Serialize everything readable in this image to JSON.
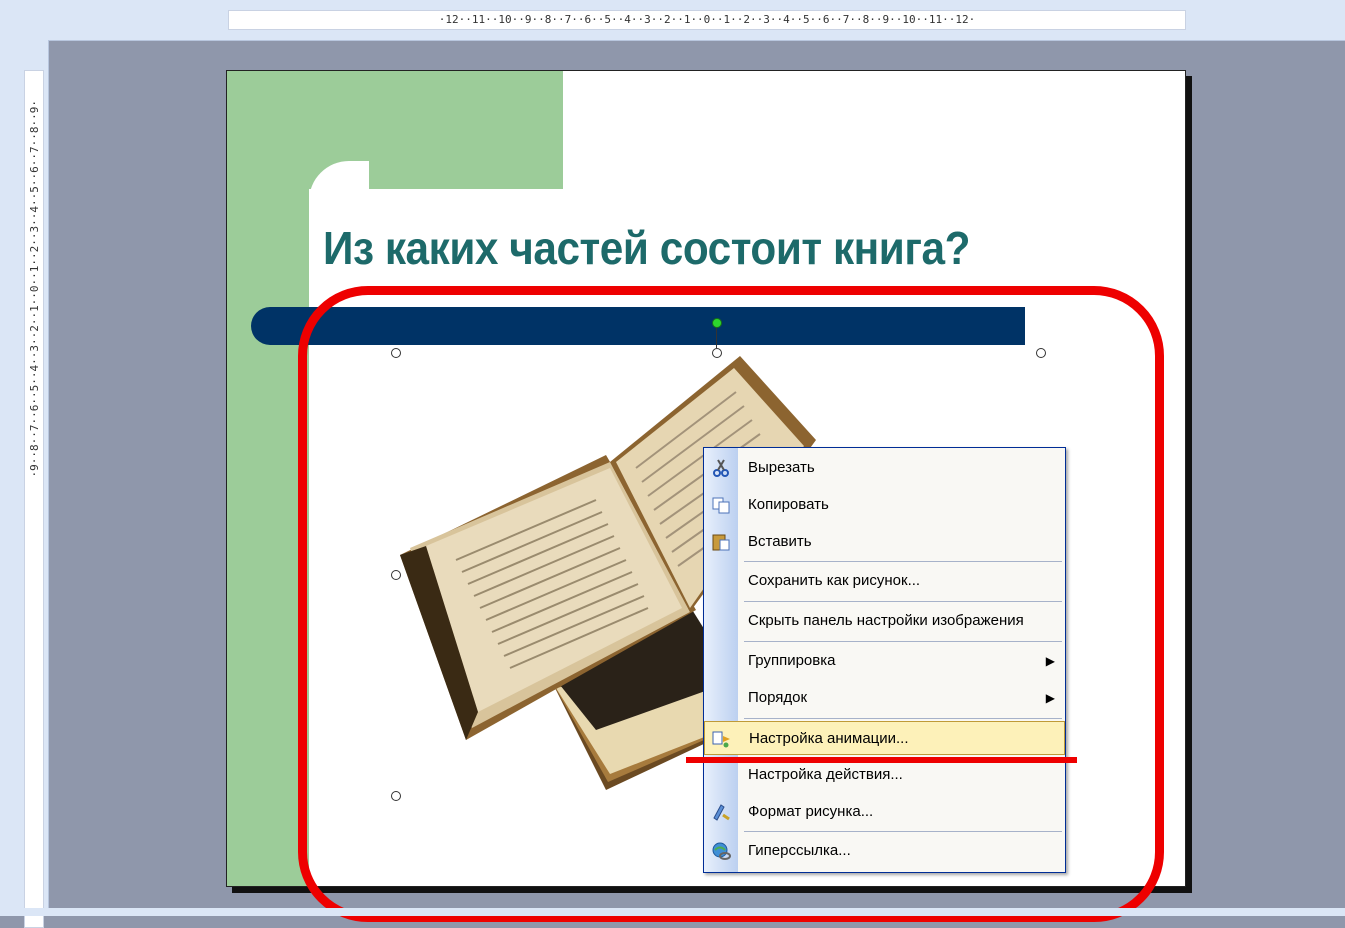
{
  "ruler": {
    "horizontal": "·12··11··10··9··8··7··6··5··4··3··2··1··0··1··2··3··4··5··6··7··8··9··10··11··12·",
    "vertical": "·9··8··7··6··5··4··3··2··1··0··1··2··3··4··5··6··7··8··9·"
  },
  "slide": {
    "title": "Из каких частей состоит книга?"
  },
  "context_menu": {
    "items": [
      {
        "label": "Вырезать",
        "icon": "scissors-icon"
      },
      {
        "label": "Копировать",
        "icon": "copy-icon"
      },
      {
        "label": "Вставить",
        "icon": "paste-icon"
      },
      {
        "label": "Сохранить как рисунок..."
      },
      {
        "label": "Скрыть панель настройки изображения"
      },
      {
        "label": "Группировка",
        "submenu": true
      },
      {
        "label": "Порядок",
        "submenu": true
      },
      {
        "label": "Настройка анимации...",
        "icon": "animation-icon",
        "highlighted": true
      },
      {
        "label": "Настройка действия..."
      },
      {
        "label": "Формат рисунка...",
        "icon": "format-picture-icon"
      },
      {
        "label": "Гиперссылка...",
        "icon": "hyperlink-icon"
      }
    ],
    "submenu_arrow": "▶"
  },
  "colors": {
    "accent_green": "#9ccc99",
    "title_teal": "#1d6a6a",
    "navy": "#003366",
    "highlight_red": "#ee0000",
    "menu_hover": "#fdf1b9"
  }
}
